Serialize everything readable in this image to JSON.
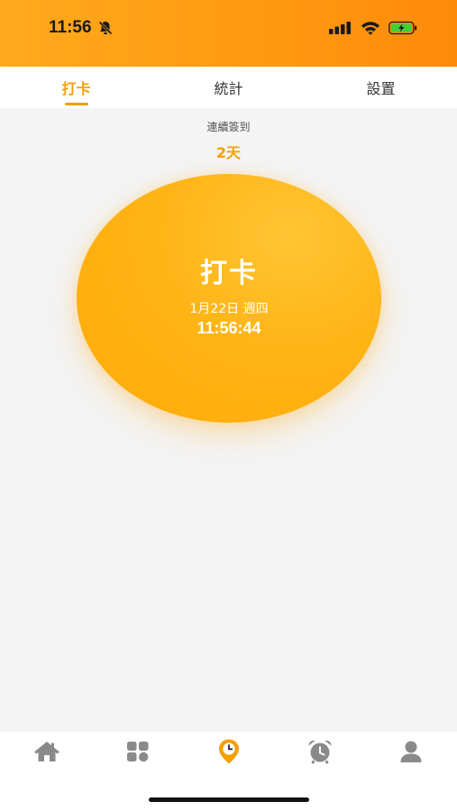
{
  "status_bar": {
    "time": "11:56",
    "bell_icon": "bell-muted-icon",
    "signal_icon": "cellular-signal-icon",
    "wifi_icon": "wifi-icon",
    "battery_icon": "battery-charging-icon"
  },
  "tabs": [
    {
      "label": "打卡",
      "active": true
    },
    {
      "label": "統計",
      "active": false
    },
    {
      "label": "設置",
      "active": false
    }
  ],
  "streak": {
    "label": "連續簽到",
    "value": "2天"
  },
  "checkin": {
    "title": "打卡",
    "date": "1月22日 週四",
    "time": "11:56:44"
  },
  "bottom_nav": [
    {
      "icon": "home-icon",
      "active": false
    },
    {
      "icon": "apps-grid-icon",
      "active": false
    },
    {
      "icon": "location-clock-icon",
      "active": true
    },
    {
      "icon": "alarm-clock-icon",
      "active": false
    },
    {
      "icon": "profile-icon",
      "active": false
    }
  ],
  "colors": {
    "accent": "#f5a000",
    "header_start": "#ffaa1e",
    "header_end": "#ff8a0a",
    "inactive_icon": "#8a8a8a"
  }
}
